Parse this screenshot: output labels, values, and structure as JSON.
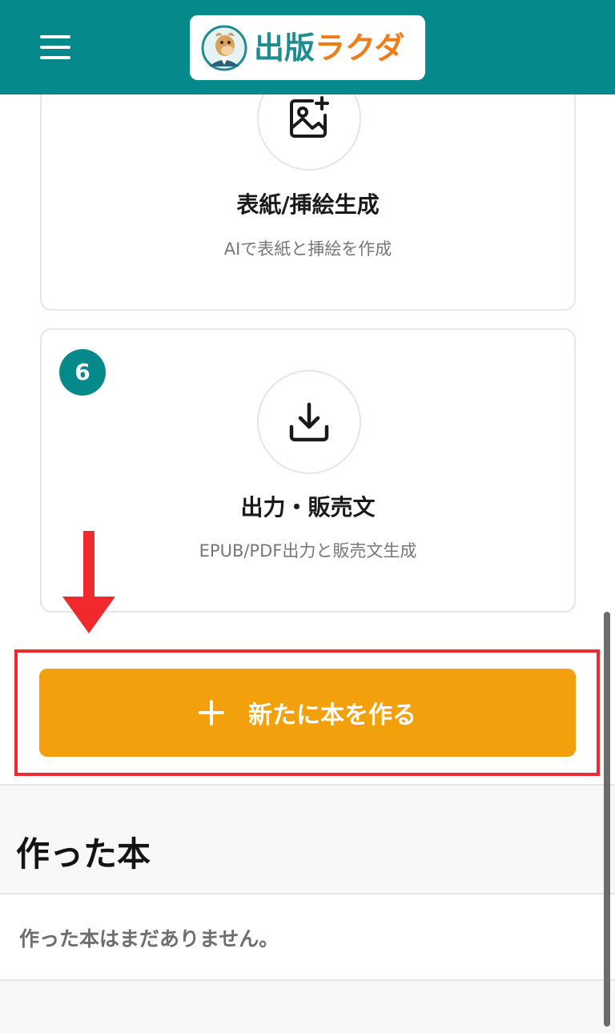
{
  "header": {
    "menu_icon": "hamburger-icon",
    "logo": {
      "icon": "camel-mascot-icon",
      "text_part1": "出版",
      "text_part2": "ラクダ"
    },
    "colors": {
      "background": "#05898b",
      "logo_part1": "#1f8c8f",
      "logo_part2": "#f07d1c"
    }
  },
  "steps": [
    {
      "icon": "image-plus-icon",
      "title": "表紙/挿絵生成",
      "description": "AIで表紙と挿絵を作成"
    },
    {
      "badge": "6",
      "icon": "download-icon",
      "title": "出力・販売文",
      "description": "EPUB/PDF出力と販売文生成"
    }
  ],
  "annotation": {
    "arrow_color": "#f0292e",
    "box_color": "#f0292e"
  },
  "create_button": {
    "icon": "plus-icon",
    "label": "新たに本を作る",
    "color": "#f2a00b"
  },
  "books": {
    "title": "作った本",
    "empty_message": "作った本はまだありません。"
  }
}
